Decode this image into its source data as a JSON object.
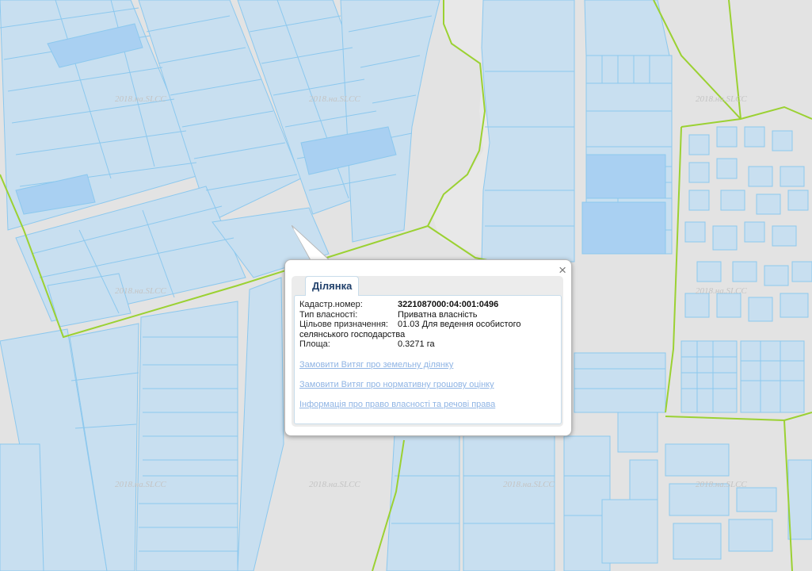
{
  "map": {
    "watermark": "2018.на.SLCC",
    "colors": {
      "background": "#e3e3e3",
      "parcel_fill": "#c8dff0",
      "parcel_stroke": "#8cc8ee",
      "highlight_fill": "#a9d0f2",
      "boundary": "#9bd132"
    }
  },
  "popup": {
    "tab_title": "Ділянка",
    "close_label": "×",
    "fields": [
      {
        "label": "Кадастр.номер:",
        "value": "3221087000:04:001:0496"
      },
      {
        "label": "Тип власності:",
        "value": "Приватна власність"
      },
      {
        "label": "Цільове призначення:",
        "value": "01.03 Для ведення особистого",
        "continuation": "селянського господарства"
      },
      {
        "label": "Площа:",
        "value": "0.3271 га"
      }
    ],
    "links": [
      "Замовити Витяг про земельну ділянку",
      "Замовити Витяг про нормативну грошову оцінку",
      "Інформація про право власності та речові права"
    ]
  }
}
